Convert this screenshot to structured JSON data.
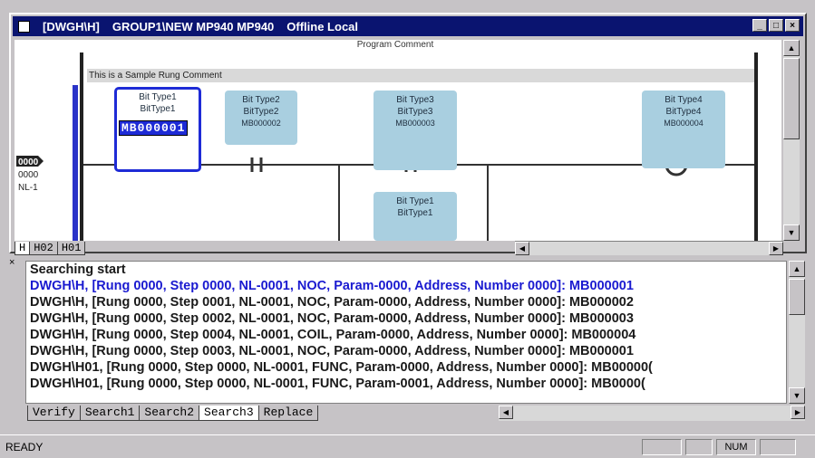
{
  "window": {
    "title_parts": [
      "[DWGH\\H]",
      "GROUP1\\NEW  MP940  MP940",
      "Offline  Local"
    ],
    "buttons": [
      "_",
      "□",
      "×"
    ]
  },
  "ladder": {
    "program_comment": "Program Comment",
    "rung_comment": "This is a Sample Rung Comment",
    "rung_label": [
      "0000",
      "0000",
      "NL-1"
    ],
    "contacts": [
      {
        "type": "Bit Type1",
        "name": "BitType1",
        "address": "MB000001"
      },
      {
        "type": "Bit Type2",
        "name": "BitType2",
        "address": "MB000002"
      },
      {
        "type": "Bit Type3",
        "name": "BitType3",
        "address": "MB000003"
      },
      {
        "type": "Bit Type4",
        "name": "BitType4",
        "address": "MB000004"
      },
      {
        "type": "Bit Type1",
        "name": "BitType1",
        "address": ""
      }
    ],
    "tabs": [
      "H",
      "H02",
      "H01"
    ]
  },
  "output": {
    "lines": [
      "Searching start",
      "DWGH\\H, [Rung 0000, Step 0000, NL-0001, NOC, Param-0000, Address, Number 0000]: MB000001",
      "DWGH\\H, [Rung 0000, Step 0001, NL-0001, NOC, Param-0000, Address, Number 0000]: MB000002",
      "DWGH\\H, [Rung 0000, Step 0002, NL-0001, NOC, Param-0000, Address, Number 0000]: MB000003",
      "DWGH\\H, [Rung 0000, Step 0004, NL-0001, COIL, Param-0000, Address, Number 0000]: MB000004",
      "DWGH\\H, [Rung 0000, Step 0003, NL-0001, NOC, Param-0000, Address, Number 0000]: MB000001",
      "DWGH\\H01, [Rung 0000, Step 0000, NL-0001, FUNC, Param-0000, Address, Number 0000]: MB00000(",
      "DWGH\\H01, [Rung 0000, Step 0000, NL-0001, FUNC, Param-0001, Address, Number 0000]: MB0000("
    ],
    "tabs": [
      "Verify",
      "Search1",
      "Search2",
      "Search3",
      "Replace"
    ],
    "active_tab": "Search3"
  },
  "status": {
    "text": "READY",
    "num": "NUM"
  },
  "colors": {
    "title_bg": "#0a1470",
    "selection": "#1e2bd6",
    "contact_bg": "#a9cfe0",
    "highlight_text": "#1a1ad0"
  }
}
